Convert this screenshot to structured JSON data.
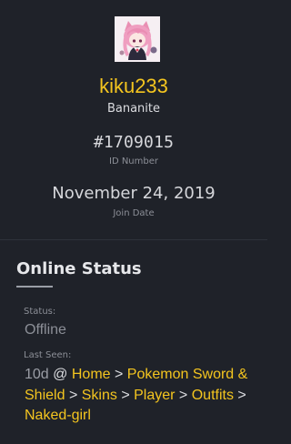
{
  "profile": {
    "username": "kiku233",
    "rank": "Bananite",
    "id_number": "#1709015",
    "id_label": "ID Number",
    "join_date": "November 24, 2019",
    "join_label": "Join Date",
    "avatar_icon": "anime-avatar-icon"
  },
  "online_status": {
    "title": "Online Status",
    "status_label": "Status:",
    "status_value": "Offline",
    "last_seen_label": "Last Seen:",
    "last_seen_ago": "10d",
    "last_seen_at": "@",
    "separator": ">",
    "breadcrumb": [
      "Home",
      "Pokemon Sword & Shield",
      "Skins",
      "Player",
      "Outfits",
      "Naked-girl"
    ]
  },
  "colors": {
    "background": "#1f2229",
    "accent": "#f4c51f",
    "muted": "#8c8f97"
  }
}
